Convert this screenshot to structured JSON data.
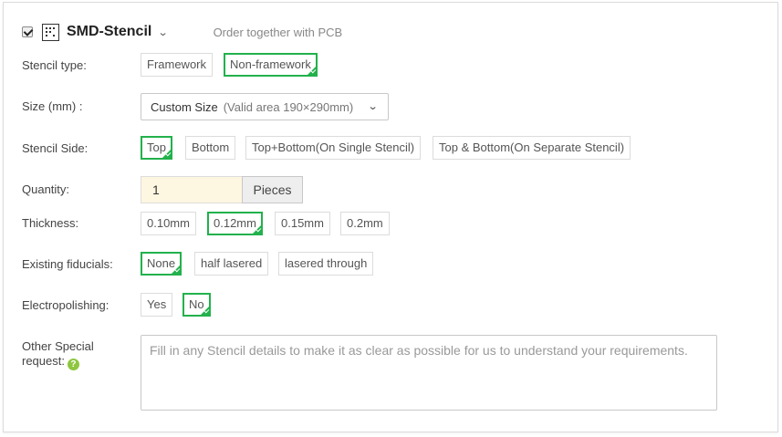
{
  "header": {
    "title": "SMD-Stencil",
    "subtitle": "Order together with PCB",
    "checked": true
  },
  "stencil_type": {
    "label": "Stencil type:",
    "options": [
      "Framework",
      "Non-framework"
    ],
    "selected": "Non-framework"
  },
  "size": {
    "label": "Size (mm) :",
    "value": "Custom Size",
    "note": "(Valid area 190×290mm)"
  },
  "stencil_side": {
    "label": "Stencil Side:",
    "options": [
      "Top",
      "Bottom",
      "Top+Bottom(On Single Stencil)",
      "Top & Bottom(On Separate Stencil)"
    ],
    "selected": "Top"
  },
  "quantity": {
    "label": "Quantity:",
    "value": "1",
    "unit": "Pieces"
  },
  "thickness": {
    "label": "Thickness:",
    "options": [
      "0.10mm",
      "0.12mm",
      "0.15mm",
      "0.2mm"
    ],
    "selected": "0.12mm"
  },
  "fiducials": {
    "label": "Existing fiducials:",
    "options": [
      "None",
      "half lasered",
      "lasered through"
    ],
    "selected": "None"
  },
  "electropolishing": {
    "label": "Electropolishing:",
    "options": [
      "Yes",
      "No"
    ],
    "selected": "No"
  },
  "special_request": {
    "label_line1": "Other Special",
    "label_line2": "request:",
    "placeholder": "Fill in any Stencil details to make it as clear as possible for us to understand your requirements."
  },
  "colors": {
    "selected_border": "#22b14c",
    "quantity_bg": "#fdf6e1",
    "help_icon": "#8ec63f"
  },
  "icons": {
    "header_check": "checkbox-checked",
    "stencil": "stencil-icon",
    "dropdown": "chevron-down-icon",
    "help": "question-circle-icon"
  }
}
